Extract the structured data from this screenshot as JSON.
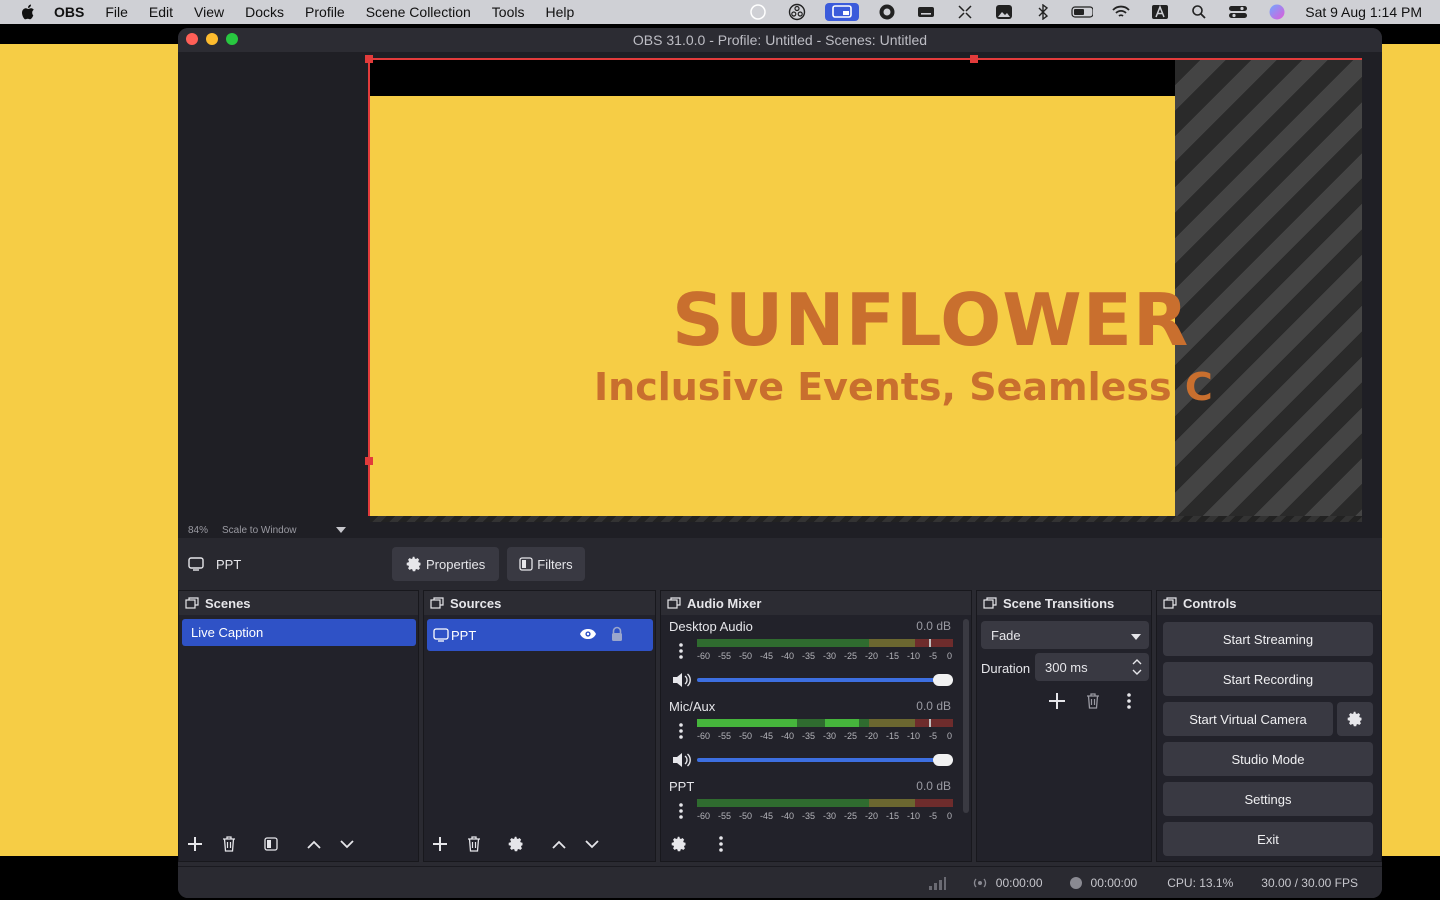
{
  "menubar": {
    "app_name": "OBS",
    "items": [
      "File",
      "Edit",
      "View",
      "Docks",
      "Profile",
      "Scene Collection",
      "Tools",
      "Help"
    ],
    "clock": "Sat 9 Aug  1:14 PM"
  },
  "window": {
    "title": "OBS 31.0.0 - Profile: Untitled - Scenes: Untitled"
  },
  "preview": {
    "headline": "SUNFLOWER",
    "tagline": "Inclusive Events, Seamless C",
    "zoom": "84%",
    "scale_mode": "Scale to Window"
  },
  "source_toolbar": {
    "selected_source": "PPT",
    "properties_label": "Properties",
    "filters_label": "Filters"
  },
  "scenes": {
    "title": "Scenes",
    "items": [
      "Live Caption"
    ]
  },
  "sources": {
    "title": "Sources",
    "items": [
      {
        "name": "PPT"
      }
    ]
  },
  "mixer": {
    "title": "Audio Mixer",
    "scale": [
      "-60",
      "-55",
      "-50",
      "-45",
      "-40",
      "-35",
      "-30",
      "-25",
      "-20",
      "-15",
      "-10",
      "-5",
      "0"
    ],
    "channels": [
      {
        "name": "Desktop Audio",
        "level": "0.0 dB"
      },
      {
        "name": "Mic/Aux",
        "level": "0.0 dB"
      },
      {
        "name": "PPT",
        "level": "0.0 dB"
      }
    ]
  },
  "transitions": {
    "title": "Scene Transitions",
    "selected": "Fade",
    "duration_label": "Duration",
    "duration_value": "300 ms"
  },
  "controls": {
    "title": "Controls",
    "start_streaming": "Start Streaming",
    "start_recording": "Start Recording",
    "start_virtual_camera": "Start Virtual Camera",
    "studio_mode": "Studio Mode",
    "settings": "Settings",
    "exit": "Exit"
  },
  "status": {
    "stream_time": "00:00:00",
    "record_time": "00:00:00",
    "cpu": "CPU: 13.1%",
    "fps": "30.00 / 30.00 FPS"
  },
  "colors": {
    "accent": "#2f52c6",
    "brand_yellow": "#f6cd45",
    "headline_orange": "#c96f2e",
    "selection_red": "#e23b3b"
  }
}
